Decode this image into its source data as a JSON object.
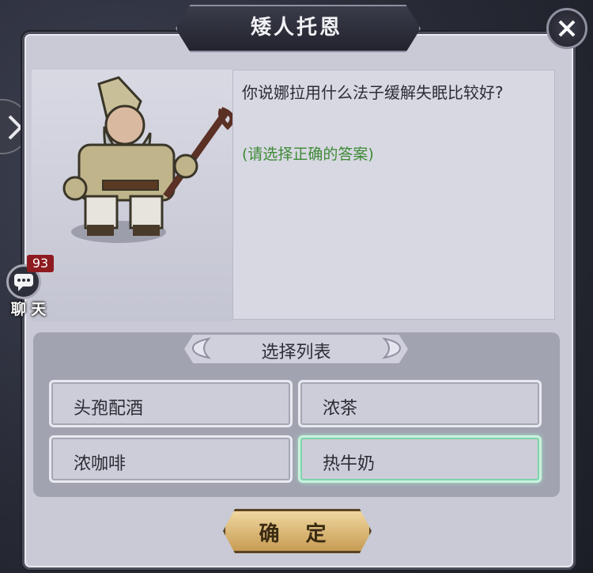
{
  "dialog": {
    "title": "矮人托恩",
    "question": "你说娜拉用什么法子缓解失眠比较好?",
    "hint": "(请选择正确的答案)"
  },
  "options_panel": {
    "header": "选择列表",
    "options": [
      {
        "label": "头孢配酒",
        "selected": false
      },
      {
        "label": "浓茶",
        "selected": false
      },
      {
        "label": "浓咖啡",
        "selected": false
      },
      {
        "label": "热牛奶",
        "selected": true
      }
    ]
  },
  "confirm_button": {
    "label": "确 定"
  },
  "chat": {
    "badge_count": "93",
    "label": "聊 天"
  },
  "icons": {
    "close": "close-icon",
    "side_tab": "chevron-right-icon",
    "chat": "chat-bubble-icon",
    "npc": "dwarf-portrait"
  },
  "colors": {
    "panel_bg": "#c9cad6",
    "hint_green": "#3f8a37",
    "selected_outline": "#7fd3ab",
    "confirm_gold": "#c79c54"
  }
}
